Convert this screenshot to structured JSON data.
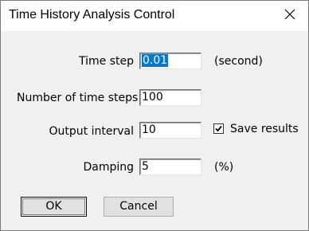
{
  "window": {
    "title": "Time History Analysis Control",
    "close_glyph": "✕"
  },
  "fields": {
    "time_step": {
      "label": "Time step",
      "value": "0.01",
      "unit": "(second)"
    },
    "num_steps": {
      "label": "Number of time steps",
      "value": "100"
    },
    "output_interval": {
      "label": "Output interval",
      "value": "10"
    },
    "damping": {
      "label": "Damping",
      "value": "5",
      "unit": "(%)"
    }
  },
  "save_results": {
    "label": "Save results",
    "checked": true
  },
  "buttons": {
    "ok": "OK",
    "cancel": "Cancel"
  },
  "colors": {
    "selection": "#0078d7",
    "dialog_bg": "#f0f0f0",
    "titlebar_bg": "#ffffff"
  },
  "icons": {
    "close": "close-icon",
    "check": "checkmark-icon"
  }
}
